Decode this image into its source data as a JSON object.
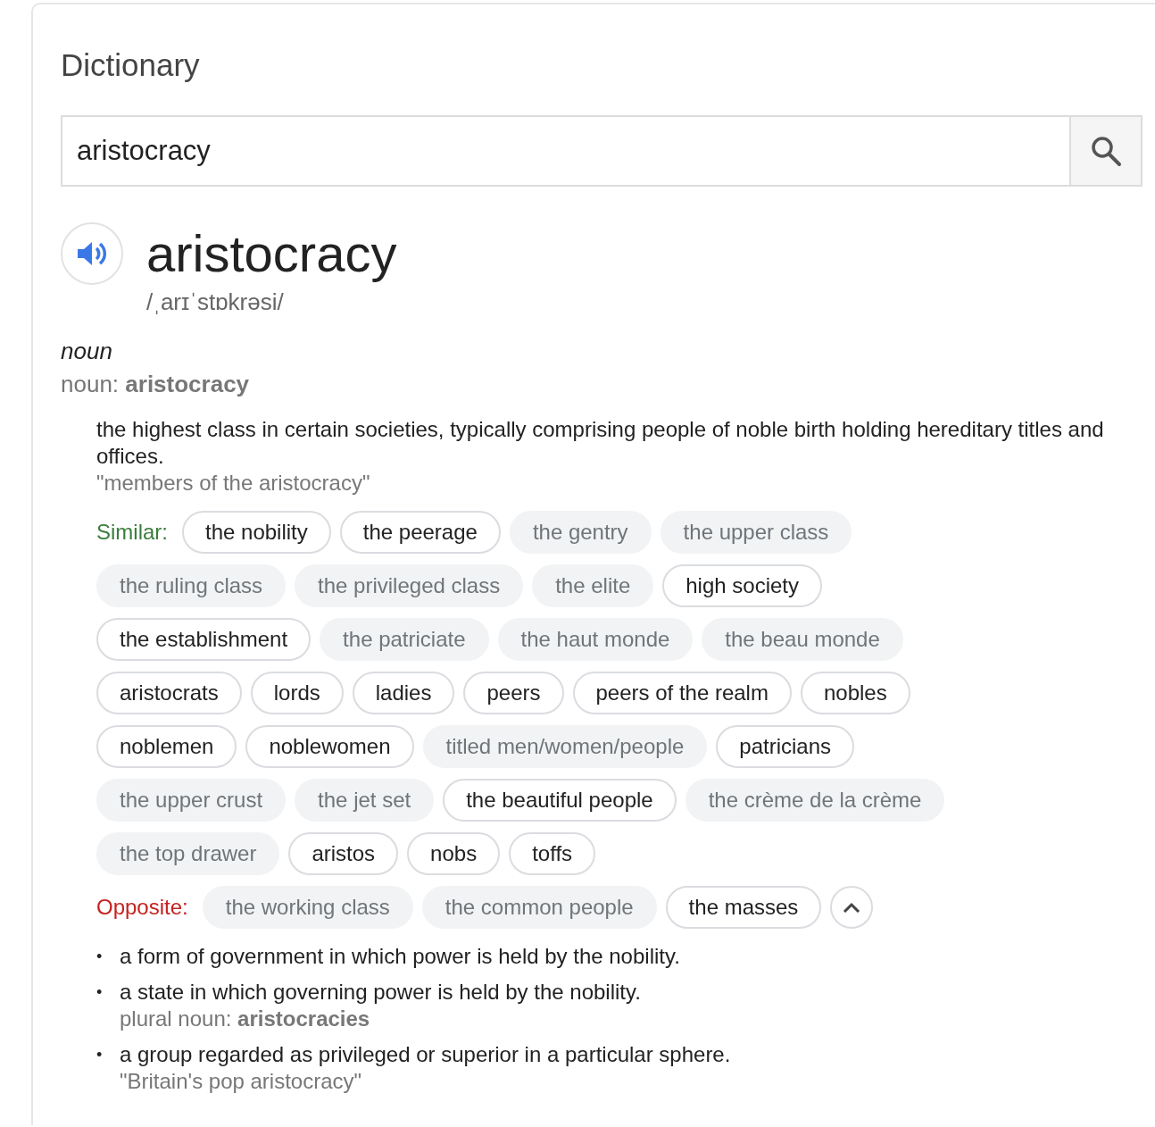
{
  "title": "Dictionary",
  "search": {
    "value": "aristocracy"
  },
  "headword": "aristocracy",
  "phonetic": "/ˌarɪˈstɒkrəsi/",
  "part_of_speech": "noun",
  "form_line": "noun: **aristocracy**",
  "definition": "the highest class in certain societies, typically comprising people of noble birth holding hereditary titles and offices.",
  "example": "\"members of the aristocracy\"",
  "similar": {
    "label": "Similar:",
    "chips": [
      {
        "text": "the nobility",
        "outlined": true
      },
      {
        "text": "the peerage",
        "outlined": true
      },
      {
        "text": "the gentry",
        "outlined": false
      },
      {
        "text": "the upper class",
        "outlined": false
      },
      {
        "text": "the ruling class",
        "outlined": false
      },
      {
        "text": "the privileged class",
        "outlined": false
      },
      {
        "text": "the elite",
        "outlined": false
      },
      {
        "text": "high society",
        "outlined": true
      },
      {
        "text": "the establishment",
        "outlined": true
      },
      {
        "text": "the patriciate",
        "outlined": false
      },
      {
        "text": "the haut monde",
        "outlined": false
      },
      {
        "text": "the beau monde",
        "outlined": false
      },
      {
        "text": "aristocrats",
        "outlined": true
      },
      {
        "text": "lords",
        "outlined": true
      },
      {
        "text": "ladies",
        "outlined": true
      },
      {
        "text": "peers",
        "outlined": true
      },
      {
        "text": "peers of the realm",
        "outlined": true
      },
      {
        "text": "nobles",
        "outlined": true
      },
      {
        "text": "noblemen",
        "outlined": true
      },
      {
        "text": "noblewomen",
        "outlined": true
      },
      {
        "text": "titled men/women/people",
        "outlined": false
      },
      {
        "text": "patricians",
        "outlined": true
      },
      {
        "text": "the upper crust",
        "outlined": false
      },
      {
        "text": "the jet set",
        "outlined": false
      },
      {
        "text": "the beautiful people",
        "outlined": true
      },
      {
        "text": "the crème de la crème",
        "outlined": false
      },
      {
        "text": "the top drawer",
        "outlined": false
      },
      {
        "text": "aristos",
        "outlined": true
      },
      {
        "text": "nobs",
        "outlined": true
      },
      {
        "text": "toffs",
        "outlined": true
      }
    ]
  },
  "opposite": {
    "label": "Opposite:",
    "expanded": true,
    "chips": [
      {
        "text": "the working class",
        "outlined": false
      },
      {
        "text": "the common people",
        "outlined": false
      },
      {
        "text": "the masses",
        "outlined": true
      }
    ]
  },
  "senses": [
    {
      "marker": "•",
      "definition": "a form of government in which power is held by the nobility."
    },
    {
      "marker": "•",
      "definition": "a state in which governing power is held by the nobility.",
      "note": "plural noun: **aristocracies**"
    },
    {
      "marker": "•",
      "definition": "a group regarded as privileged or superior in a particular sphere.",
      "example": "\"Britain's pop aristocracy\""
    }
  ]
}
